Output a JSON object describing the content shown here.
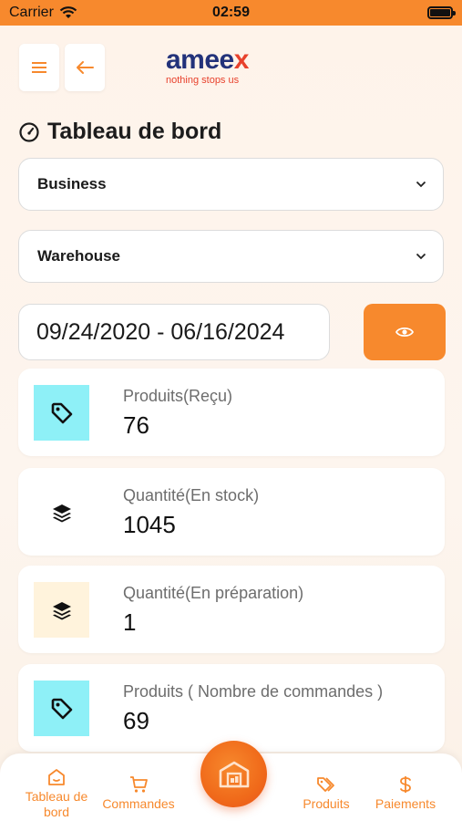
{
  "status_bar": {
    "carrier": "Carrier",
    "time": "02:59"
  },
  "header": {
    "menu_icon": "menu-icon",
    "back_icon": "arrow-left-icon",
    "logo_text_main": "amee",
    "logo_text_x": "x",
    "logo_tagline": "nothing stops us"
  },
  "page": {
    "title": "Tableau de bord",
    "title_icon": "gauge-icon"
  },
  "filters": {
    "business": "Business",
    "warehouse": "Warehouse",
    "date_range": "09/24/2020 - 06/16/2024"
  },
  "stats": [
    {
      "label": "Produits(Reçu)",
      "value": "76",
      "icon": "tag-icon",
      "icon_bg": "#8ef0f7"
    },
    {
      "label": "Quantité(En stock)",
      "value": "1045",
      "icon": "layers-icon",
      "icon_bg": "#ffffff"
    },
    {
      "label": "Quantité(En préparation)",
      "value": "1",
      "icon": "layers-icon",
      "icon_bg": "#fff3dc"
    },
    {
      "label": "Produits ( Nombre de commandes )",
      "value": "69",
      "icon": "tag-icon",
      "icon_bg": "#8ef0f7"
    }
  ],
  "bottom_nav": {
    "dashboard": "Tableau de bord",
    "orders": "Commandes",
    "center_icon": "warehouse-icon",
    "products": "Produits",
    "payments": "Paiements"
  },
  "colors": {
    "accent": "#f7892d",
    "brand_blue": "#23327a",
    "brand_red": "#e8412c"
  }
}
